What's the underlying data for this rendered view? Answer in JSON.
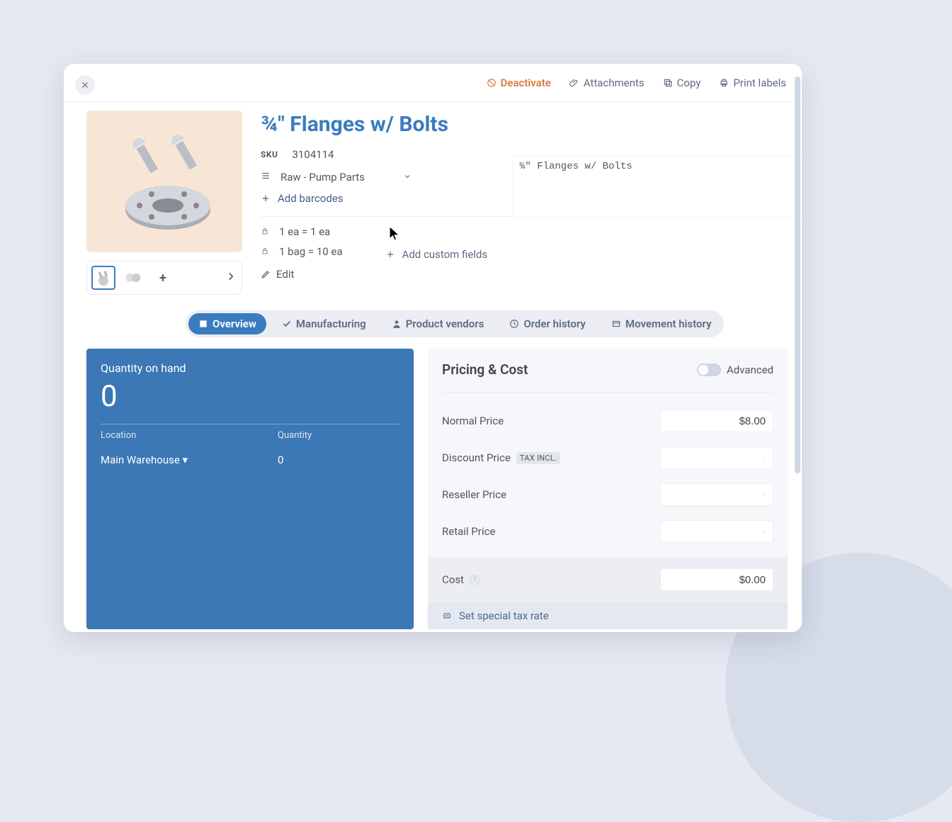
{
  "topbar": {
    "deactivate": "Deactivate",
    "attachments": "Attachments",
    "copy": "Copy",
    "print_labels": "Print labels"
  },
  "product": {
    "title": "¾\" Flanges w/ Bolts",
    "sku_label": "SKU",
    "sku_value": "3104114",
    "description": "¾\" Flanges w/ Bolts",
    "category": "Raw - Pump Parts",
    "add_barcodes": "Add barcodes",
    "uom1": "1 ea = 1 ea",
    "uom2": "1 bag = 10 ea",
    "edit": "Edit",
    "add_custom_fields": "Add custom fields"
  },
  "tabs": {
    "overview": "Overview",
    "manufacturing": "Manufacturing",
    "vendors": "Product vendors",
    "order_history": "Order history",
    "movement_history": "Movement history"
  },
  "qoh": {
    "title": "Quantity on hand",
    "total": "0",
    "col_location": "Location",
    "col_qty": "Quantity",
    "row_location": "Main Warehouse ▾",
    "row_qty": "0"
  },
  "pricing": {
    "title": "Pricing & Cost",
    "advanced": "Advanced",
    "normal_label": "Normal Price",
    "normal_value": "$8.00",
    "discount_label": "Discount Price",
    "discount_tax": "TAX INCL.",
    "discount_value": "-",
    "reseller_label": "Reseller Price",
    "reseller_value": "-",
    "retail_label": "Retail Price",
    "retail_value": "-",
    "cost_label": "Cost",
    "cost_value": "$0.00",
    "special_tax": "Set special tax rate"
  }
}
